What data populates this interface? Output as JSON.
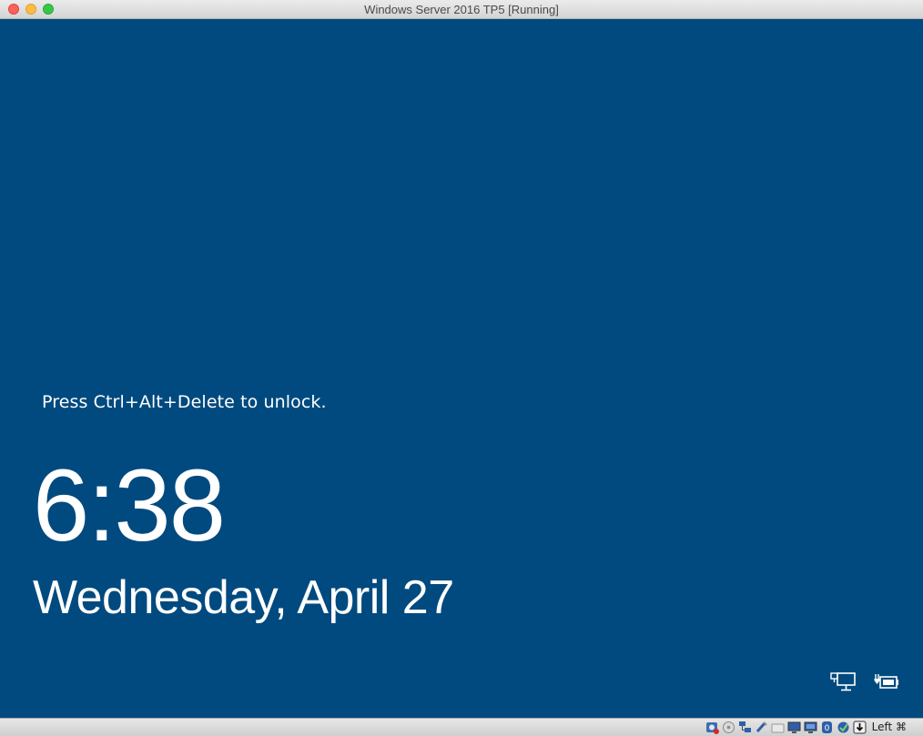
{
  "window": {
    "title": "Windows Server 2016 TP5 [Running]",
    "controls": [
      "close",
      "minimize",
      "zoom"
    ]
  },
  "lock_screen": {
    "background_color": "#004a7f",
    "prompt": "Press Ctrl+Alt+Delete to unlock.",
    "time": "6:38",
    "date": "Wednesday, April 27",
    "corner_icons": [
      "network-icon",
      "power-icon"
    ]
  },
  "statusbar": {
    "icons": [
      "hard-disk-icon",
      "optical-drive-icon",
      "network-adapters-icon",
      "usb-icon",
      "shared-folders-icon",
      "display-icon",
      "video-capture-icon",
      "mouse-integration-icon",
      "guest-additions-icon",
      "host-key-arrow-icon"
    ],
    "host_key": "Left ⌘"
  }
}
